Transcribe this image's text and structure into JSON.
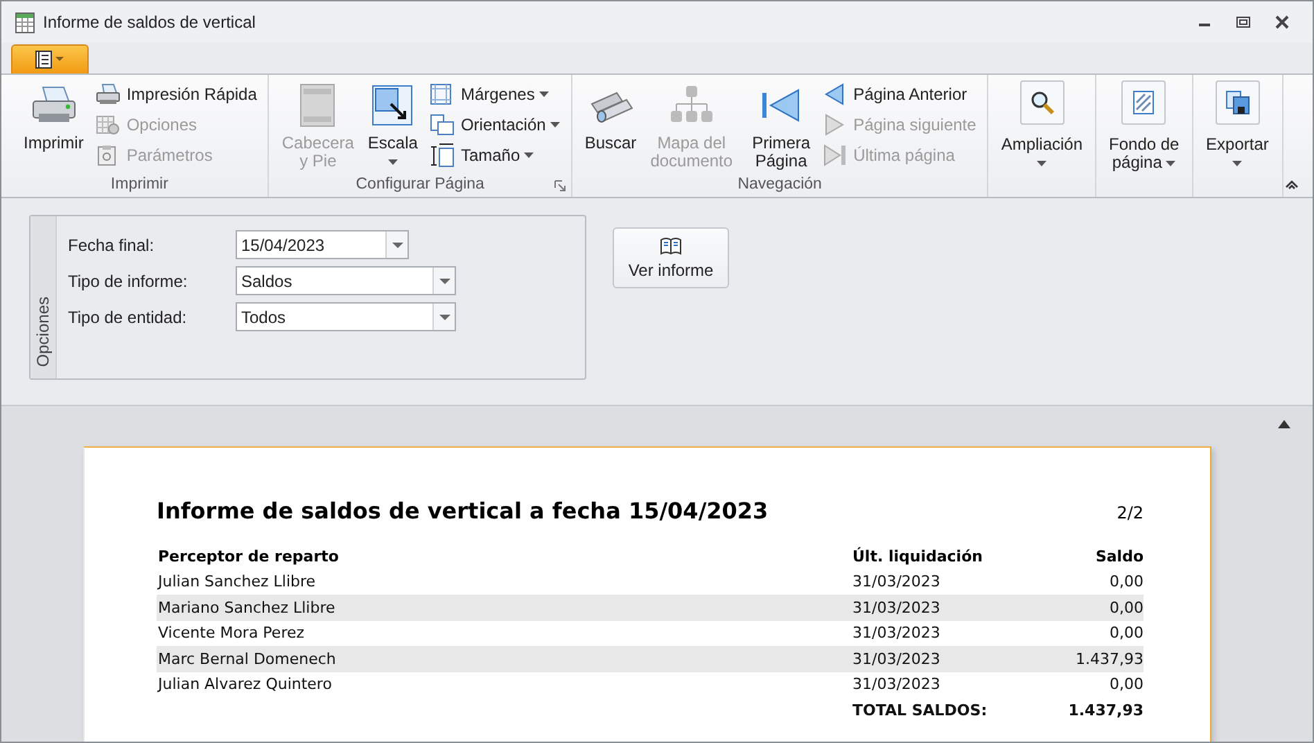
{
  "window": {
    "title": "Informe de saldos de vertical"
  },
  "ribbon": {
    "groups": [
      {
        "label": "Imprimir",
        "items": [
          {
            "kind": "large",
            "label": "Imprimir",
            "disabled": false,
            "dropdown": false
          },
          {
            "kind": "small",
            "label": "Impresión Rápida",
            "disabled": false,
            "dropdown": false
          },
          {
            "kind": "small",
            "label": "Opciones",
            "disabled": true,
            "dropdown": false
          },
          {
            "kind": "small",
            "label": "Parámetros",
            "disabled": true,
            "dropdown": false
          }
        ]
      },
      {
        "label": "Configurar Página",
        "launcher": true,
        "items": [
          {
            "kind": "large",
            "label": "Cabecera\ny Pie",
            "disabled": true,
            "dropdown": false
          },
          {
            "kind": "large",
            "label": "Escala",
            "disabled": false,
            "dropdown": true
          },
          {
            "kind": "small",
            "label": "Márgenes",
            "disabled": false,
            "dropdown": true
          },
          {
            "kind": "small",
            "label": "Orientación",
            "disabled": false,
            "dropdown": true
          },
          {
            "kind": "small",
            "label": "Tamaño",
            "disabled": false,
            "dropdown": true
          }
        ]
      },
      {
        "label": "Navegación",
        "items": [
          {
            "kind": "large",
            "label": "Buscar",
            "disabled": false,
            "dropdown": false
          },
          {
            "kind": "large",
            "label": "Mapa del\ndocumento",
            "disabled": true,
            "dropdown": false
          },
          {
            "kind": "separator"
          },
          {
            "kind": "large",
            "label": "Primera\nPágina",
            "disabled": false,
            "dropdown": false
          },
          {
            "kind": "small",
            "label": "Página Anterior",
            "disabled": false,
            "dropdown": false
          },
          {
            "kind": "small",
            "label": "Página siguiente",
            "disabled": true,
            "dropdown": false
          },
          {
            "kind": "small",
            "label": "Última página",
            "disabled": true,
            "dropdown": false
          }
        ]
      },
      {
        "items": [
          {
            "kind": "boxed",
            "label": "Ampliación",
            "disabled": false,
            "dropdown": true
          }
        ]
      },
      {
        "items": [
          {
            "kind": "boxed",
            "label": "Fondo de\npágina",
            "disabled": false,
            "dropdown": true
          }
        ]
      },
      {
        "items": [
          {
            "kind": "boxed",
            "label": "Exportar",
            "disabled": false,
            "dropdown": true
          }
        ]
      }
    ]
  },
  "options": {
    "tab": "Opciones",
    "fields": [
      {
        "kind": "date",
        "label": "Fecha final:",
        "value": "15/04/2023"
      },
      {
        "kind": "select",
        "label": "Tipo de informe:",
        "value": "Saldos"
      },
      {
        "kind": "select",
        "label": "Tipo de entidad:",
        "value": "Todos"
      }
    ],
    "button": "Ver informe"
  },
  "report": {
    "title": "Informe de saldos de vertical a fecha 15/04/2023",
    "page": "2/2",
    "columns": [
      "Perceptor de reparto",
      "Últ. liquidación",
      "Saldo"
    ],
    "rows": [
      [
        "Julian Sanchez Llibre",
        "31/03/2023",
        "0,00"
      ],
      [
        "Mariano Sanchez Llibre",
        "31/03/2023",
        "0,00"
      ],
      [
        "Vicente Mora Perez",
        "31/03/2023",
        "0,00"
      ],
      [
        "Marc Bernal Domenech",
        "31/03/2023",
        "1.437,93"
      ],
      [
        "Julian Alvarez Quintero",
        "31/03/2023",
        "0,00"
      ]
    ],
    "total_label": "TOTAL SALDOS:",
    "total_value": "1.437,93"
  }
}
